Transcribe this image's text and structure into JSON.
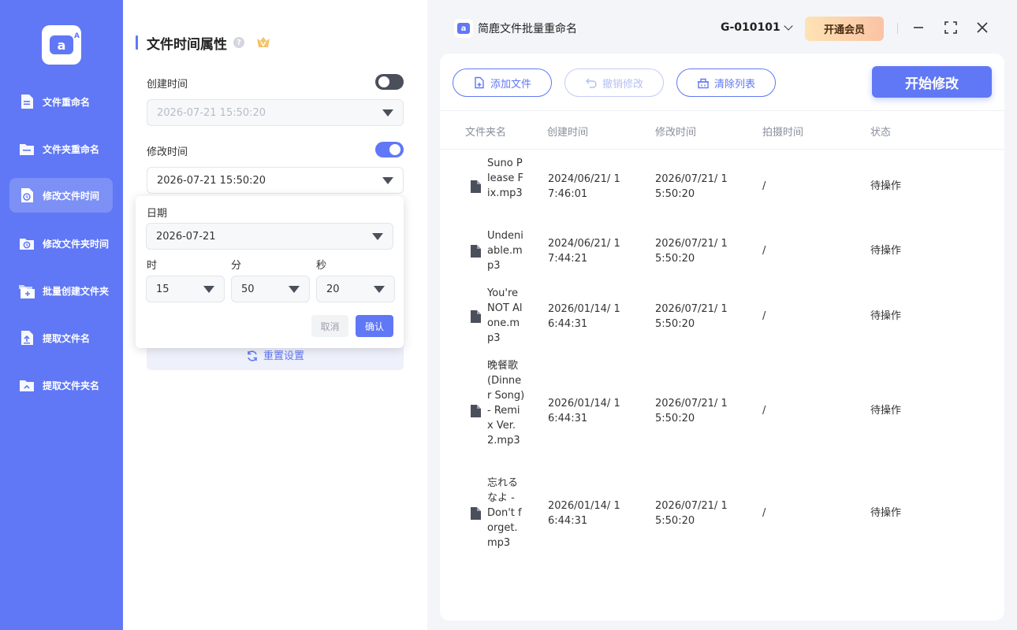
{
  "sidebar": {
    "items": [
      {
        "label": "文件重命名",
        "active": false
      },
      {
        "label": "文件夹重命名",
        "active": false
      },
      {
        "label": "修改文件时间",
        "active": true
      },
      {
        "label": "修改文件夹时间",
        "active": false
      },
      {
        "label": "批量创建文件夹",
        "active": false
      },
      {
        "label": "提取文件名",
        "active": false
      },
      {
        "label": "提取文件夹名",
        "active": false
      }
    ]
  },
  "panel": {
    "title": "文件时间属性",
    "help": "?",
    "created": {
      "label": "创建时间",
      "enabled": false,
      "value": "2026-07-21 15:50:20"
    },
    "modified": {
      "label": "修改时间",
      "enabled": true,
      "value": "2026-07-21 15:50:20"
    },
    "reset_label": "重置设置"
  },
  "picker": {
    "date_label": "日期",
    "date_value": "2026-07-21",
    "hour_label": "时",
    "minute_label": "分",
    "second_label": "秒",
    "hour": "15",
    "minute": "50",
    "second": "20",
    "cancel": "取消",
    "confirm": "确认"
  },
  "header": {
    "app_title": "简鹿文件批量重命名",
    "user_id": "G-010101",
    "vip_label": "开通会员"
  },
  "toolbar": {
    "add": "添加文件",
    "undo": "撤销修改",
    "clear": "清除列表",
    "start": "开始修改"
  },
  "table": {
    "columns": [
      "文件夹名",
      "创建时间",
      "修改时间",
      "拍摄时间",
      "状态"
    ],
    "rows": [
      {
        "name": "Suno Please Fix.mp3",
        "created": "2024/06/21/ 17:46:01",
        "modified": "2026/07/21/ 15:50:20",
        "shot": "/",
        "status": "待操作"
      },
      {
        "name": "Undeniable.mp3",
        "created": "2024/06/21/ 17:44:21",
        "modified": "2026/07/21/ 15:50:20",
        "shot": "/",
        "status": "待操作"
      },
      {
        "name": "You're NOT Alone.mp3",
        "created": "2026/01/14/ 16:44:31",
        "modified": "2026/07/21/ 15:50:20",
        "shot": "/",
        "status": "待操作"
      },
      {
        "name": "晚餐歌 (Dinner Song) - Remix Ver. 2.mp3",
        "created": "2026/01/14/ 16:44:31",
        "modified": "2026/07/21/ 15:50:20",
        "shot": "/",
        "status": "待操作"
      },
      {
        "name": "忘れるなよ - Don't forget.mp3",
        "created": "2026/01/14/ 16:44:31",
        "modified": "2026/07/21/ 15:50:20",
        "shot": "/",
        "status": "待操作"
      }
    ]
  },
  "colors": {
    "accent": "#6078f5",
    "sidebar": "#6078f5"
  }
}
